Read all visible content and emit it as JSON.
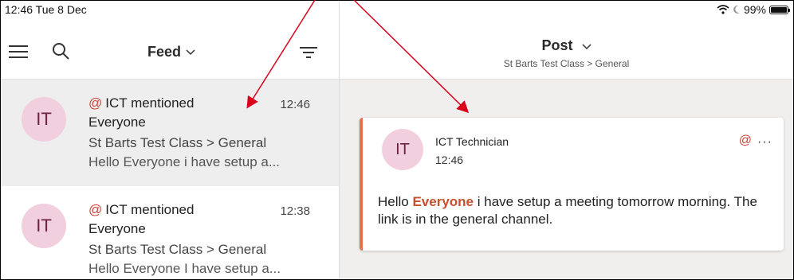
{
  "status_bar": {
    "time_date": "12:46  Tue 8 Dec",
    "battery": "99%",
    "battery_level": 0.99,
    "icons": [
      "wifi-icon",
      "moon-icon",
      "battery-icon"
    ]
  },
  "left_pane": {
    "feed_title": "Feed",
    "feed_chevron": "⌵",
    "items": [
      {
        "avatar": "IT",
        "mention_symbol": "@",
        "mention_text": "ICT mentioned",
        "time": "12:46",
        "line2": "Everyone",
        "channel": "St Barts Test Class > General",
        "preview": "Hello Everyone i have setup a..."
      },
      {
        "avatar": "IT",
        "mention_symbol": "@",
        "mention_text": "ICT mentioned",
        "time": "12:38",
        "line2": "Everyone",
        "channel": "St Barts Test Class > General",
        "preview": "Hello Everyone I have setup a..."
      }
    ]
  },
  "right_pane": {
    "title": "Post",
    "title_chevron": "⌵",
    "breadcrumb": "St Barts Test Class > General",
    "post": {
      "avatar": "IT",
      "author": "ICT Technician",
      "time": "12:46",
      "mention_symbol": "@",
      "more": "···",
      "message_before": "Hello ",
      "message_mention": "Everyone",
      "message_after": " i have setup a meeting tomorrow morning. The link is in the general channel."
    }
  },
  "colors": {
    "accent": "#e7714a",
    "mention": "#d0443c",
    "annotation_arrow": "#d9001b",
    "avatar_bg": "#f2cfdf"
  }
}
